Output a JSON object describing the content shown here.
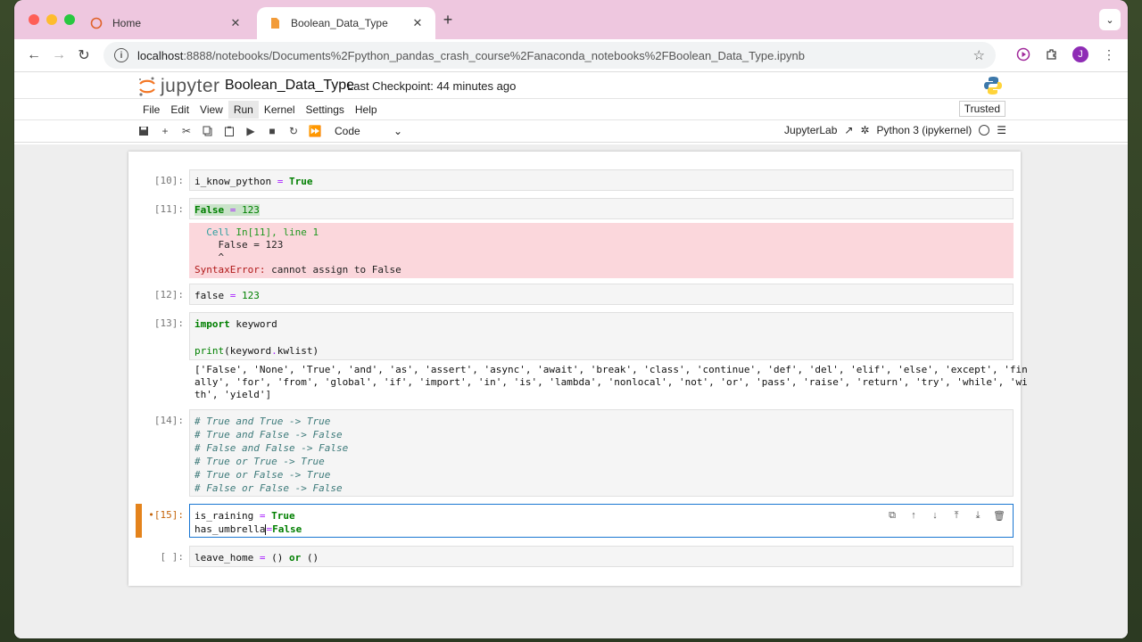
{
  "browser": {
    "tabs": [
      {
        "title": "Home",
        "active": false
      },
      {
        "title": "Boolean_Data_Type",
        "active": true
      }
    ],
    "url_host": "localhost",
    "url_rest": ":8888/notebooks/Documents%2Fpython_pandas_crash_course%2Fanaconda_notebooks%2FBoolean_Data_Type.ipynb",
    "avatar_letter": "J"
  },
  "jupyter": {
    "logo_text": "jupyter",
    "notebook_title": "Boolean_Data_Type",
    "checkpoint": "Last Checkpoint: 44 minutes ago",
    "menu": [
      "File",
      "Edit",
      "View",
      "Run",
      "Kernel",
      "Settings",
      "Help"
    ],
    "active_menu": "Run",
    "trusted": "Trusted",
    "cell_type": "Code",
    "jupyterlab_link": "JupyterLab",
    "kernel": "Python 3 (ipykernel)"
  },
  "cells": {
    "c10": {
      "prompt": "[10]:"
    },
    "c11": {
      "prompt": "[11]:",
      "err_line1": "Cell In[11], line 1",
      "err_code": "False = 123",
      "err_caret": "^",
      "err_name": "SyntaxError:",
      "err_msg": " cannot assign to False"
    },
    "c12": {
      "prompt": "[12]:"
    },
    "c13": {
      "prompt": "[13]:",
      "output": "['False', 'None', 'True', 'and', 'as', 'assert', 'async', 'await', 'break', 'class', 'continue', 'def', 'del', 'elif', 'else', 'except', 'fin\nally', 'for', 'from', 'global', 'if', 'import', 'in', 'is', 'lambda', 'nonlocal', 'not', 'or', 'pass', 'raise', 'return', 'try', 'while', 'wi\nth', 'yield']"
    },
    "c14": {
      "prompt": "[14]:",
      "lines": [
        "# True and True -> True",
        "# True and False -> False",
        "# False and False -> False",
        "# True or True -> True",
        "# True or False -> True",
        "# False or False -> False"
      ]
    },
    "c15": {
      "prompt": "•[15]:"
    },
    "c16": {
      "prompt": "[ ]:"
    }
  }
}
